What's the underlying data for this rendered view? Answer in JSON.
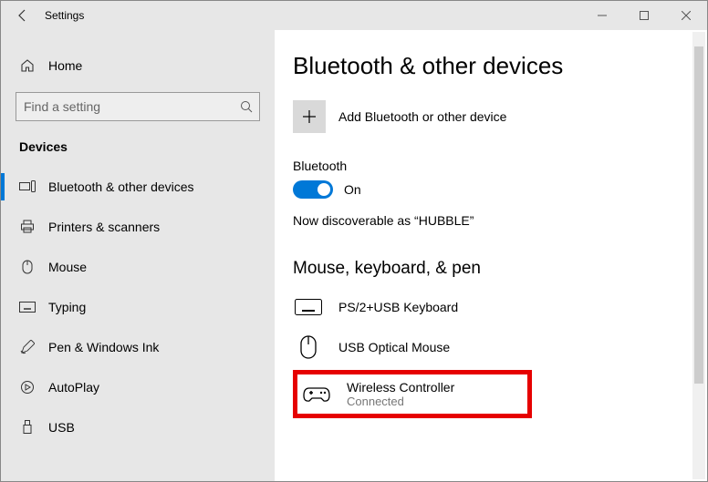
{
  "window": {
    "title": "Settings"
  },
  "sidebar": {
    "home_label": "Home",
    "search_placeholder": "Find a setting",
    "section_label": "Devices",
    "items": [
      {
        "label": "Bluetooth & other devices"
      },
      {
        "label": "Printers & scanners"
      },
      {
        "label": "Mouse"
      },
      {
        "label": "Typing"
      },
      {
        "label": "Pen & Windows Ink"
      },
      {
        "label": "AutoPlay"
      },
      {
        "label": "USB"
      }
    ]
  },
  "content": {
    "page_title": "Bluetooth & other devices",
    "add_label": "Add Bluetooth or other device",
    "bluetooth_label": "Bluetooth",
    "toggle_state": "On",
    "discoverable_text": "Now discoverable as “HUBBLE”",
    "group_title": "Mouse, keyboard, & pen",
    "devices": [
      {
        "name": "PS/2+USB Keyboard",
        "status": ""
      },
      {
        "name": "USB Optical Mouse",
        "status": ""
      },
      {
        "name": "Wireless Controller",
        "status": "Connected"
      }
    ]
  }
}
